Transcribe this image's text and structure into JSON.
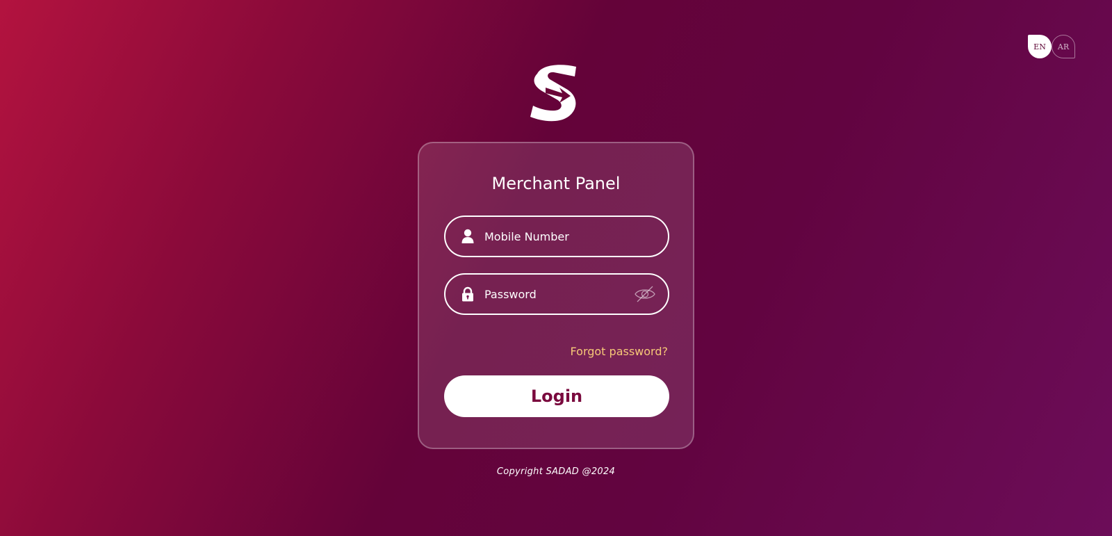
{
  "language_switch": {
    "options": [
      {
        "code": "EN",
        "active": true
      },
      {
        "code": "AR",
        "active": false
      }
    ]
  },
  "logo": {
    "icon": "sadad-s-logo-icon"
  },
  "login_card": {
    "title": "Merchant Panel",
    "mobile_field": {
      "placeholder": "Mobile Number",
      "value": "",
      "icon": "user-icon"
    },
    "password_field": {
      "placeholder": "Password",
      "value": "",
      "icon": "lock-icon",
      "toggle_icon": "eye-off-icon"
    },
    "forgot_password": "Forgot password?",
    "login_button": "Login"
  },
  "footer": {
    "copyright": "Copyright SADAD @2024"
  },
  "colors": {
    "background_start": "#b3133f",
    "background_mid": "#640339",
    "background_end": "#6c0d59",
    "button_text": "#7a0a3e",
    "link": "#f7c978"
  }
}
